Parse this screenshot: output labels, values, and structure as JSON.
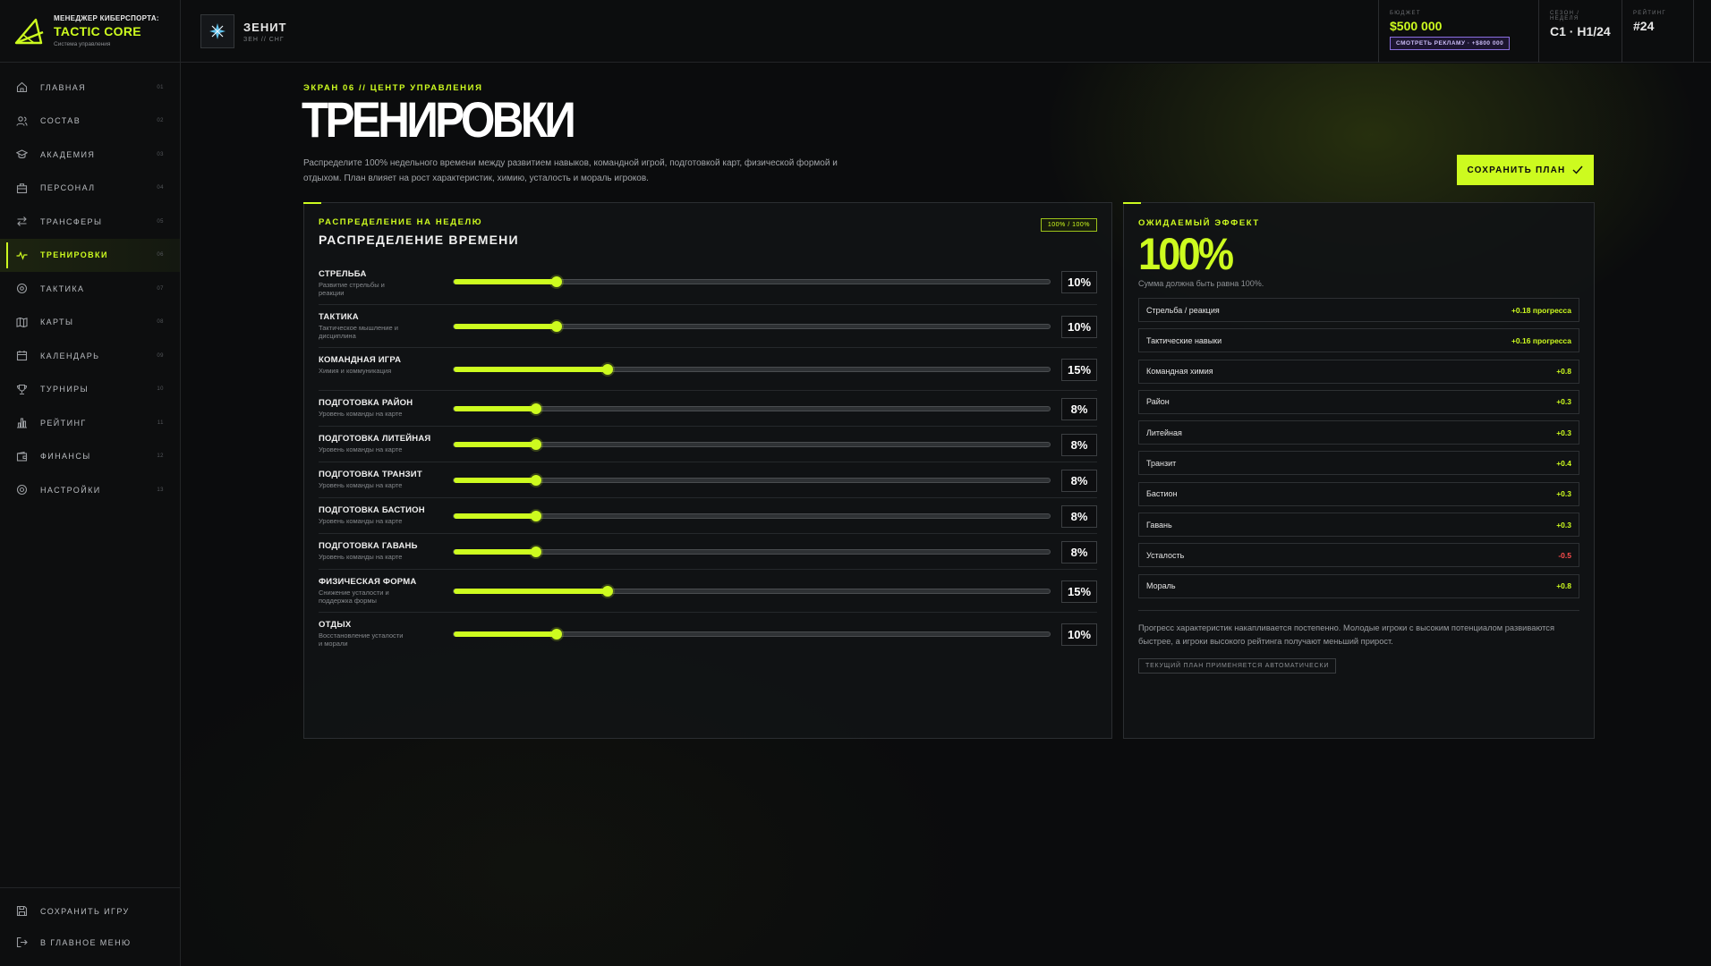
{
  "brand": {
    "top": "МЕНЕДЖЕР КИБЕРСПОРТА:",
    "name": "TACTIC CORE",
    "sub": "Система управления"
  },
  "nav": [
    {
      "label": "ГЛАВНАЯ",
      "num": "01",
      "icon": "home-icon"
    },
    {
      "label": "СОСТАВ",
      "num": "02",
      "icon": "users-icon"
    },
    {
      "label": "АКАДЕМИЯ",
      "num": "03",
      "icon": "graduation-cap-icon"
    },
    {
      "label": "ПЕРСОНАЛ",
      "num": "04",
      "icon": "briefcase-icon"
    },
    {
      "label": "ТРАНСФЕРЫ",
      "num": "05",
      "icon": "transfer-arrows-icon"
    },
    {
      "label": "ТРЕНИРОВКИ",
      "num": "06",
      "icon": "pulse-icon",
      "active": true
    },
    {
      "label": "ТАКТИКА",
      "num": "07",
      "icon": "crosshair-icon"
    },
    {
      "label": "КАРТЫ",
      "num": "08",
      "icon": "map-icon"
    },
    {
      "label": "КАЛЕНДАРЬ",
      "num": "09",
      "icon": "calendar-icon"
    },
    {
      "label": "ТУРНИРЫ",
      "num": "10",
      "icon": "trophy-icon"
    },
    {
      "label": "РЕЙТИНГ",
      "num": "11",
      "icon": "bar-chart-icon"
    },
    {
      "label": "ФИНАНСЫ",
      "num": "12",
      "icon": "wallet-icon"
    },
    {
      "label": "НАСТРОЙКИ",
      "num": "13",
      "icon": "settings-icon"
    }
  ],
  "side_bottom": {
    "save_label": "СОХРАНИТЬ ИГРУ",
    "menu_label": "В ГЛАВНОЕ МЕНЮ"
  },
  "team": {
    "name": "ЗЕНИТ",
    "sub": "ЗЕН // СНГ"
  },
  "stats": {
    "budget_label": "БЮДЖЕТ",
    "budget_value": "$500 000",
    "ad_button": "СМОТРЕТЬ РЕКЛАМУ · +$800 000",
    "season_label": "СЕЗОН / НЕДЕЛЯ",
    "season_value": "С1 · Н1/24",
    "rating_label": "РЕЙТИНГ",
    "rating_value": "#24"
  },
  "page": {
    "tag": "ЭКРАН 06 // ЦЕНТР УПРАВЛЕНИЯ",
    "title": "ТРЕНИРОВКИ",
    "description": "Распределите 100% недельного времени между развитием навыков, командной игрой, подготовкой карт, физической формой и отдыхом. План влияет на рост характеристик, химию, усталость и мораль игроков.",
    "save_plan": "СОХРАНИТЬ ПЛАН"
  },
  "allocation": {
    "kicker": "РАСПРЕДЕЛЕНИЕ НА НЕДЕЛЮ",
    "title": "РАСПРЕДЕЛЕНИЕ ВРЕМЕНИ",
    "badge": "100% / 100%",
    "items": [
      {
        "name": "СТРЕЛЬБА",
        "desc": "Развитие стрельбы и реакции",
        "value": 10,
        "label": "10%"
      },
      {
        "name": "ТАКТИКА",
        "desc": "Тактическое мышление и дисциплина",
        "value": 10,
        "label": "10%"
      },
      {
        "name": "КОМАНДНАЯ ИГРА",
        "desc": "Химия и коммуникация",
        "value": 15,
        "label": "15%"
      },
      {
        "name": "ПОДГОТОВКА РАЙОН",
        "desc": "Уровень команды на карте",
        "value": 8,
        "label": "8%"
      },
      {
        "name": "ПОДГОТОВКА ЛИТЕЙНАЯ",
        "desc": "Уровень команды на карте",
        "value": 8,
        "label": "8%"
      },
      {
        "name": "ПОДГОТОВКА ТРАНЗИТ",
        "desc": "Уровень команды на карте",
        "value": 8,
        "label": "8%"
      },
      {
        "name": "ПОДГОТОВКА БАСТИОН",
        "desc": "Уровень команды на карте",
        "value": 8,
        "label": "8%"
      },
      {
        "name": "ПОДГОТОВКА ГАВАНЬ",
        "desc": "Уровень команды на карте",
        "value": 8,
        "label": "8%"
      },
      {
        "name": "ФИЗИЧЕСКАЯ ФОРМА",
        "desc": "Снижение усталости и поддержка формы",
        "value": 15,
        "label": "15%"
      },
      {
        "name": "ОТДЫХ",
        "desc": "Восстановление усталости и морали",
        "value": 10,
        "label": "10%"
      }
    ]
  },
  "effect": {
    "kicker": "ОЖИДАЕМЫЙ ЭФФЕКТ",
    "total": "100%",
    "note": "Сумма должна быть равна 100%.",
    "rows": [
      {
        "name": "Стрельба / реакция",
        "value": "+0.18 прогресса",
        "negative": false
      },
      {
        "name": "Тактические навыки",
        "value": "+0.16 прогресса",
        "negative": false
      },
      {
        "name": "Командная химия",
        "value": "+0.8",
        "negative": false
      },
      {
        "name": "Район",
        "value": "+0.3",
        "negative": false
      },
      {
        "name": "Литейная",
        "value": "+0.3",
        "negative": false
      },
      {
        "name": "Транзит",
        "value": "+0.4",
        "negative": false
      },
      {
        "name": "Бастион",
        "value": "+0.3",
        "negative": false
      },
      {
        "name": "Гавань",
        "value": "+0.3",
        "negative": false
      },
      {
        "name": "Усталость",
        "value": "-0.5",
        "negative": true
      },
      {
        "name": "Мораль",
        "value": "+0.8",
        "negative": false
      }
    ],
    "progress_note": "Прогресс характеристик накапливается постепенно. Молодые игроки с высоким потенциалом развиваются быстрее, а игроки высокого рейтинга получают меньший прирост.",
    "auto_badge": "ТЕКУЩИЙ ПЛАН ПРИМЕНЯЕТСЯ АВТОМАТИЧЕСКИ"
  },
  "colors": {
    "accent": "#cdfb1f",
    "negative": "#ff4d4d",
    "ad_border": "#8b6fe0"
  }
}
